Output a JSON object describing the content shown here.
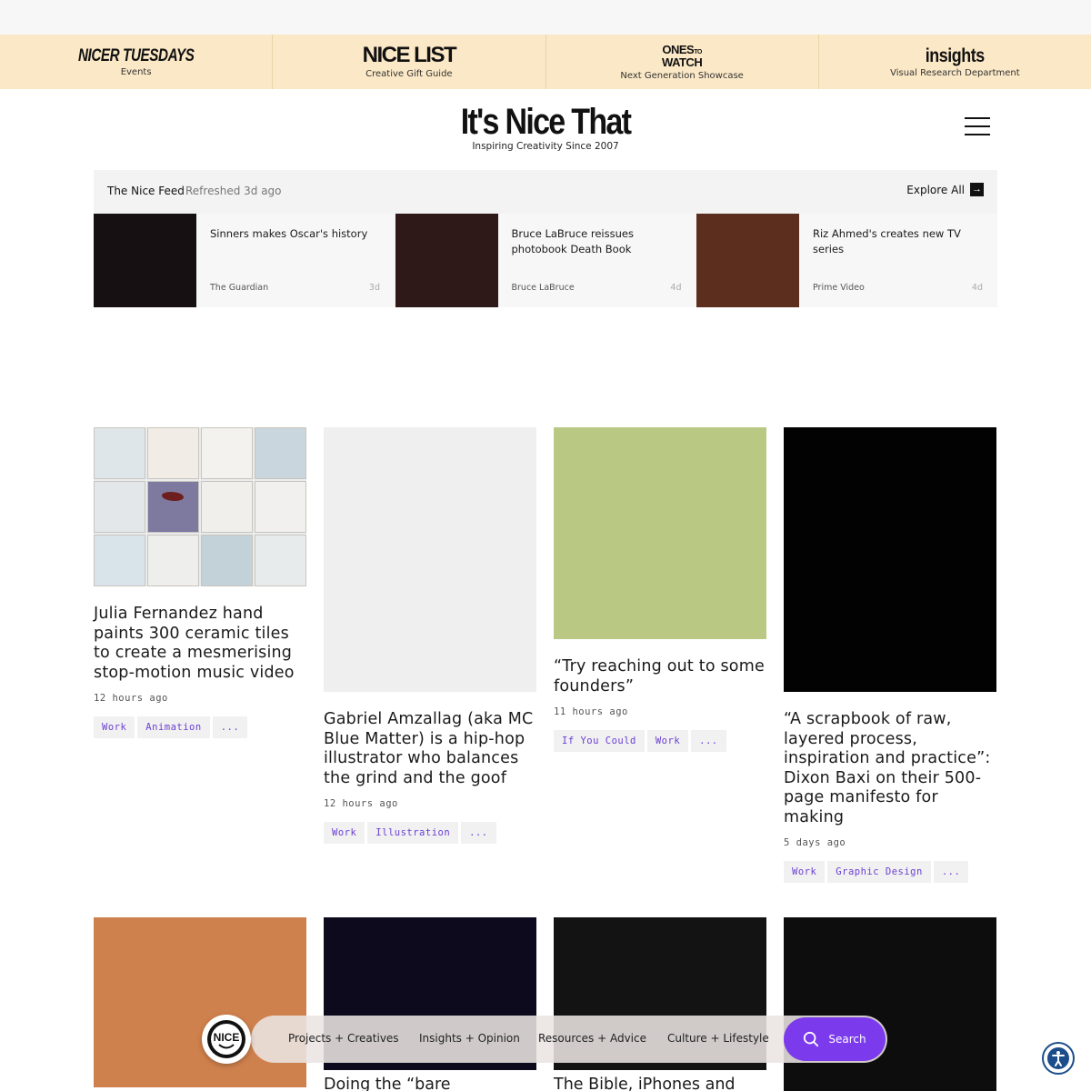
{
  "brands": [
    {
      "logo": "NICER TUESDAYS",
      "sub": "Events"
    },
    {
      "logo": "NICE LIST",
      "sub": "Creative Gift Guide"
    },
    {
      "logo_line1": "ONES",
      "logo_to": "TO",
      "logo_line2": "WATCH",
      "sub": "Next Generation Showcase"
    },
    {
      "logo": "insights",
      "sub": "Visual Research Department"
    }
  ],
  "site": {
    "title": "It's Nice That",
    "tagline": "Inspiring Creativity Since 2007"
  },
  "feed": {
    "title": "The Nice Feed",
    "refreshed": "Refreshed 3d ago",
    "explore_label": "Explore All",
    "items": [
      {
        "headline": "Sinners makes Oscar's history",
        "source": "The Guardian",
        "age": "3d",
        "thumb_color": "#161012"
      },
      {
        "headline": "Bruce LaBruce reissues photobook Death Book",
        "source": "Bruce LaBruce",
        "age": "4d",
        "thumb_color": "#2e1818"
      },
      {
        "headline": "Riz Ahmed's creates new TV series",
        "source": "Prime Video",
        "age": "4d",
        "thumb_color": "#5c2e1e"
      }
    ]
  },
  "articles": [
    {
      "title": "Julia Fernandez hand paints 300 ceramic tiles to create a mesmerising stop-motion music video",
      "time": "12 hours ago",
      "tags": [
        "Work",
        "Animation",
        "..."
      ]
    },
    {
      "title": "Gabriel Amzallag (aka MC Blue Matter) is a hip-hop illustrator who balances the grind and the goof",
      "time": "12 hours ago",
      "tags": [
        "Work",
        "Illustration",
        "..."
      ],
      "image_color": "#efefef"
    },
    {
      "title": "“Try reaching out to some founders”",
      "time": "11 hours ago",
      "tags": [
        "If You Could",
        "Work",
        "..."
      ],
      "image_color": "#b9c984"
    },
    {
      "title": "“A scrapbook of raw, layered process, inspiration and practice”: Dixon Baxi on their 500-page manifesto for making",
      "time": "5 days ago",
      "tags": [
        "Work",
        "Graphic Design",
        "..."
      ],
      "image_color": "#020202"
    }
  ],
  "bottom_articles": [
    {
      "title": "",
      "image_color": "#cf814d"
    },
    {
      "title": "Doing the “bare maximum”",
      "image_color": "#0c0a1c"
    },
    {
      "title": "The Bible, iPhones and",
      "image_color": "#131313"
    },
    {
      "title": "",
      "image_color": "#0d0d0d"
    }
  ],
  "dock": {
    "links": [
      "Projects + Creatives",
      "Insights + Opinion",
      "Resources + Advice",
      "Culture + Lifestyle"
    ],
    "search_label": "Search",
    "accent": "#7c3aed"
  },
  "icons": {
    "menu": "hamburger-icon",
    "explore": "arrow-right-icon",
    "search": "search-icon",
    "accessibility": "accessibility-icon",
    "badge": "nice-logo-icon"
  }
}
